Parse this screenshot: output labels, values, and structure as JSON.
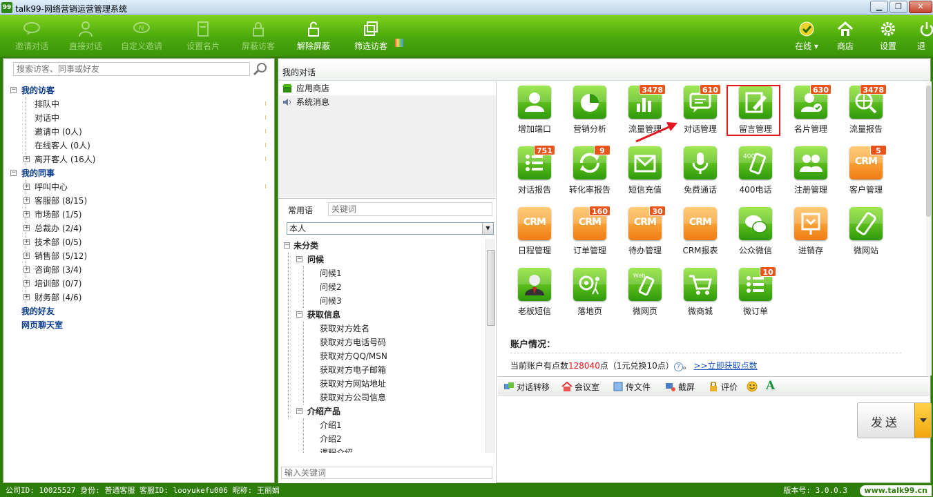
{
  "window": {
    "logo": "99",
    "title": "talk99-网络营销运营管理系统"
  },
  "toolbar": {
    "invite_chat": "邀请对话",
    "direct_chat": "直接对话",
    "custom_invite": "自定义邀请",
    "set_card": "设置名片",
    "block_visitor": "屏蔽访客",
    "unblock": "解除屏蔽",
    "filter_visitor": "筛选访客",
    "online": "在线",
    "store": "商店",
    "settings": "设置",
    "exit": "退"
  },
  "left": {
    "search_placeholder": "搜索访客、同事或好友",
    "my_visitors": "我的访客",
    "visitors": [
      "排队中",
      "对话中",
      "邀请中 (0人)",
      "在线客人 (0人)",
      "离开客人 (16人)"
    ],
    "my_colleagues": "我的同事",
    "departments": [
      "呼叫中心",
      "客服部 (8/15)",
      "市场部 (1/5)",
      "总裁办 (2/4)",
      "技术部 (0/5)",
      "销售部 (5/12)",
      "咨询部 (3/4)",
      "培训部 (0/7)",
      "财务部 (4/6)"
    ],
    "my_friends": "我的好友",
    "chatroom": "网页聊天室"
  },
  "main": {
    "header": "我的对话",
    "app_list": [
      "应用商店",
      "系统消息"
    ],
    "phrases": {
      "label": "常用语",
      "search_placeholder": "关键词",
      "scope": "本人",
      "tree": {
        "root": "未分类",
        "groups": [
          {
            "label": "问候",
            "items": [
              "问候1",
              "问候2",
              "问候3"
            ]
          },
          {
            "label": "获取信息",
            "items": [
              "获取对方姓名",
              "获取对方电话号码",
              "获取对方QQ/MSN",
              "获取对方电子邮箱",
              "获取对方网站地址",
              "获取对方公司信息"
            ]
          },
          {
            "label": "介绍产品",
            "items": [
              "介绍1",
              "介绍2",
              "课程介绍"
            ]
          }
        ]
      },
      "input_placeholder": "输入关键词"
    }
  },
  "apps": [
    {
      "label": "增加端口",
      "badge": "",
      "icon": "user-icon",
      "color": "green"
    },
    {
      "label": "营销分析",
      "badge": "",
      "icon": "pie-chart-icon",
      "color": "green"
    },
    {
      "label": "流量管理",
      "badge": "3478",
      "icon": "bar-chart-icon",
      "color": "green"
    },
    {
      "label": "对话管理",
      "badge": "610",
      "icon": "chat-bubble-icon",
      "color": "green"
    },
    {
      "label": "留言管理",
      "badge": "",
      "icon": "edit-note-icon",
      "color": "green"
    },
    {
      "label": "名片管理",
      "badge": "630",
      "icon": "card-icon",
      "color": "green"
    },
    {
      "label": "流量报告",
      "badge": "3478",
      "icon": "globe-search-icon",
      "color": "green"
    },
    {
      "label": "对话报告",
      "badge": "751",
      "icon": "list-icon",
      "color": "green"
    },
    {
      "label": "转化率报告",
      "badge": "9",
      "icon": "refresh-icon",
      "color": "green"
    },
    {
      "label": "短信充值",
      "badge": "",
      "icon": "envelope-icon",
      "color": "green"
    },
    {
      "label": "免费通话",
      "badge": "",
      "icon": "microphone-icon",
      "color": "green"
    },
    {
      "label": "400电话",
      "badge": "",
      "icon": "phone-400-icon",
      "color": "green"
    },
    {
      "label": "注册管理",
      "badge": "",
      "icon": "users-icon",
      "color": "green"
    },
    {
      "label": "客户管理",
      "badge": "5",
      "icon": "crm-icon",
      "color": "orange"
    },
    {
      "label": "日程管理",
      "badge": "",
      "icon": "crm-icon",
      "color": "orange"
    },
    {
      "label": "订单管理",
      "badge": "160",
      "icon": "crm-icon",
      "color": "orange"
    },
    {
      "label": "待办管理",
      "badge": "30",
      "icon": "crm-icon",
      "color": "orange"
    },
    {
      "label": "CRM报表",
      "badge": "",
      "icon": "crm-icon",
      "color": "orange"
    },
    {
      "label": "公众微信",
      "badge": "",
      "icon": "wechat-icon",
      "color": "green"
    },
    {
      "label": "进销存",
      "badge": "",
      "icon": "inventory-icon",
      "color": "orange"
    },
    {
      "label": "微网站",
      "badge": "",
      "icon": "mobile-icon",
      "color": "green"
    },
    {
      "label": "老板短信",
      "badge": "",
      "icon": "boss-avatar-icon",
      "color": "green"
    },
    {
      "label": "落地页",
      "badge": "",
      "icon": "at-walker-icon",
      "color": "green"
    },
    {
      "label": "微网页",
      "badge": "",
      "icon": "web-mobile-icon",
      "color": "green"
    },
    {
      "label": "微商城",
      "badge": "",
      "icon": "cart-icon",
      "color": "green"
    },
    {
      "label": "微订单",
      "badge": "10",
      "icon": "list-icon",
      "color": "green"
    }
  ],
  "account": {
    "title": "账户情况：",
    "prefix": "当前账户有点数",
    "points": "128040",
    "suffix": "点（1元兑换10点）",
    "help": "?",
    "link": ">>立即获取点数"
  },
  "chat_tools": {
    "transfer": "对话转移",
    "meeting": "会议室",
    "file": "传文件",
    "screenshot": "截屏",
    "rate": "评价",
    "emoji_icon": "smiley-icon",
    "font_icon": "font-A-icon"
  },
  "send": {
    "label": "发送"
  },
  "status": {
    "left": "公司ID: 10025527  身份: 普通客服  客服ID: looyukefu006  昵称: 王丽娟",
    "version": "版本号: 3.0.0.3",
    "url": "www.talk99.cn"
  },
  "colors": {
    "toolbar": "#4aa80c",
    "accent_red": "#e2161e",
    "badge": "#e8541b",
    "link": "#1b55c2"
  }
}
